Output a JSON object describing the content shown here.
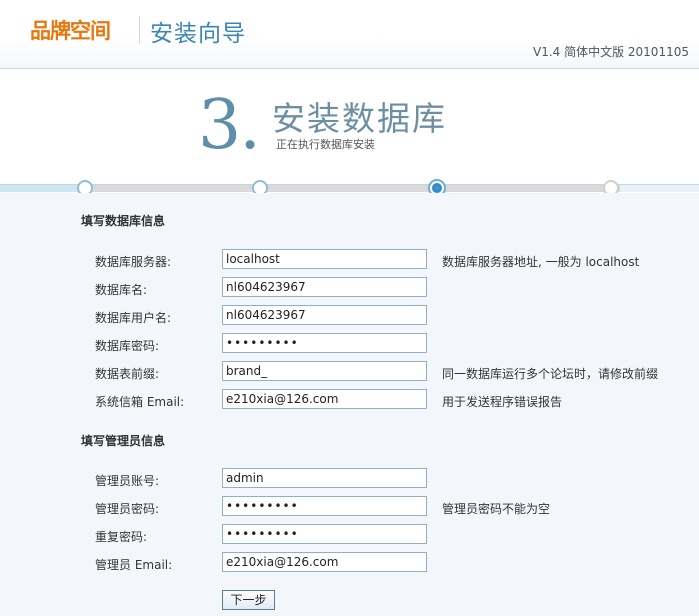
{
  "header": {
    "logo_text": "品牌空间",
    "wizard_title": "安装向导",
    "version": "V1.4 简体中文版 20101105"
  },
  "step": {
    "number": "3.",
    "title": "安装数据库",
    "subtitle": "正在执行数据库安装",
    "current": 3,
    "total": 4
  },
  "db_section": {
    "title": "填写数据库信息",
    "fields": [
      {
        "label": "数据库服务器:",
        "value": "localhost",
        "note": "数据库服务器地址, 一般为  localhost"
      },
      {
        "label": "数据库名:",
        "value": "nl604623967",
        "note": ""
      },
      {
        "label": "数据库用户名:",
        "value": "nl604623967",
        "note": ""
      },
      {
        "label": "数据库密码:",
        "value": "•••••••••",
        "note": ""
      },
      {
        "label": "数据表前缀:",
        "value": "brand_",
        "note": "同一数据库运行多个论坛时，请修改前缀"
      },
      {
        "label": "系统信箱  Email:",
        "value": "e210xia@126.com",
        "note": "用于发送程序错误报告"
      }
    ]
  },
  "admin_section": {
    "title": "填写管理员信息",
    "fields": [
      {
        "label": "管理员账号:",
        "value": "admin",
        "note": ""
      },
      {
        "label": "管理员密码:",
        "value": "•••••••••",
        "note": "管理员密码不能为空"
      },
      {
        "label": "重复密码:",
        "value": "•••••••••",
        "note": ""
      },
      {
        "label": "管理员  Email:",
        "value": "e210xia@126.com",
        "note": ""
      }
    ]
  },
  "buttons": {
    "next_label": "下一步"
  },
  "colors": {
    "accent": "#3a86b5",
    "logo": "#e8770e",
    "form_bg": "#f3f7fb"
  }
}
